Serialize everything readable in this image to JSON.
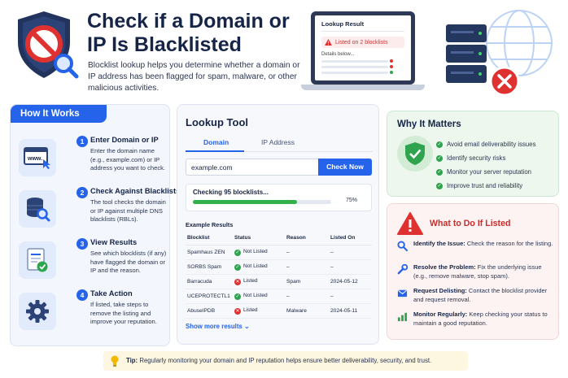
{
  "header": {
    "title": "Check if a Domain or IP Is Blacklisted",
    "subtitle": "Blocklist lookup helps you determine whether a domain or IP address has been flagged for spam, malware, or other malicious activities."
  },
  "laptop": {
    "title": "Lookup Result",
    "alert": "Listed on 2 blocklists",
    "details": "Details below..."
  },
  "how_it_works": {
    "title": "How It Works",
    "steps": [
      {
        "num": "1",
        "title": "Enter Domain or IP",
        "desc": "Enter the domain name (e.g., example.com) or IP address you want to check.",
        "icon": "www-cursor-icon"
      },
      {
        "num": "2",
        "title": "Check Against Blacklists",
        "desc": "The tool checks the domain or IP against multiple DNS blacklists (RBLs).",
        "icon": "database-search-icon"
      },
      {
        "num": "3",
        "title": "View Results",
        "desc": "See which blocklists (if any) have flagged the domain or IP and the reason.",
        "icon": "report-check-icon"
      },
      {
        "num": "4",
        "title": "Take Action",
        "desc": "If listed, take steps to remove the listing and improve your reputation.",
        "icon": "gear-icon"
      }
    ]
  },
  "lookup": {
    "title": "Lookup Tool",
    "tabs": [
      "Domain",
      "IP Address"
    ],
    "active_tab": "Domain",
    "input_value": "example.com",
    "button": "Check Now",
    "progress_label": "Checking 95 blocklists...",
    "progress_percent": 75,
    "progress_text": "75%",
    "examples_label": "Example Results",
    "columns": [
      "Blocklist",
      "Status",
      "Reason",
      "Listed On"
    ],
    "rows": [
      {
        "blocklist": "Spamhaus ZEN",
        "status": "Not Listed",
        "listed": false,
        "reason": "–",
        "listed_on": "–"
      },
      {
        "blocklist": "SORBS Spam",
        "status": "Not Listed",
        "listed": false,
        "reason": "–",
        "listed_on": "–"
      },
      {
        "blocklist": "Barracuda",
        "status": "Listed",
        "listed": true,
        "reason": "Spam",
        "listed_on": "2024-05-12"
      },
      {
        "blocklist": "UCEPROTECTL1",
        "status": "Not Listed",
        "listed": false,
        "reason": "–",
        "listed_on": "–"
      },
      {
        "blocklist": "AbuseIPDB",
        "status": "Listed",
        "listed": true,
        "reason": "Malware",
        "listed_on": "2024-05-11"
      }
    ],
    "more_link": "Show more results"
  },
  "why_matters": {
    "title": "Why It Matters",
    "items": [
      "Avoid email deliverability issues",
      "Identify security risks",
      "Monitor your server reputation",
      "Improve trust and reliability"
    ]
  },
  "todo": {
    "title": "What to Do If Listed",
    "items": [
      {
        "bold": "Identify the Issue:",
        "text": " Check the reason for the listing.",
        "icon": "search-icon"
      },
      {
        "bold": "Resolve the Problem:",
        "text": " Fix the underlying issue (e.g., remove malware, stop spam).",
        "icon": "wrench-icon"
      },
      {
        "bold": "Request Delisting:",
        "text": " Contact the blocklist provider and request removal.",
        "icon": "envelope-icon"
      },
      {
        "bold": "Monitor Regularly:",
        "text": " Keep checking your status to maintain a good reputation.",
        "icon": "bar-chart-icon"
      }
    ]
  },
  "tip": {
    "label": "Tip:",
    "text": " Regularly monitoring your domain and IP reputation helps ensure better deliverability, security, and trust."
  },
  "colors": {
    "primary": "#2563eb",
    "success": "#2ea44f",
    "danger": "#e03131",
    "heading": "#152447"
  }
}
